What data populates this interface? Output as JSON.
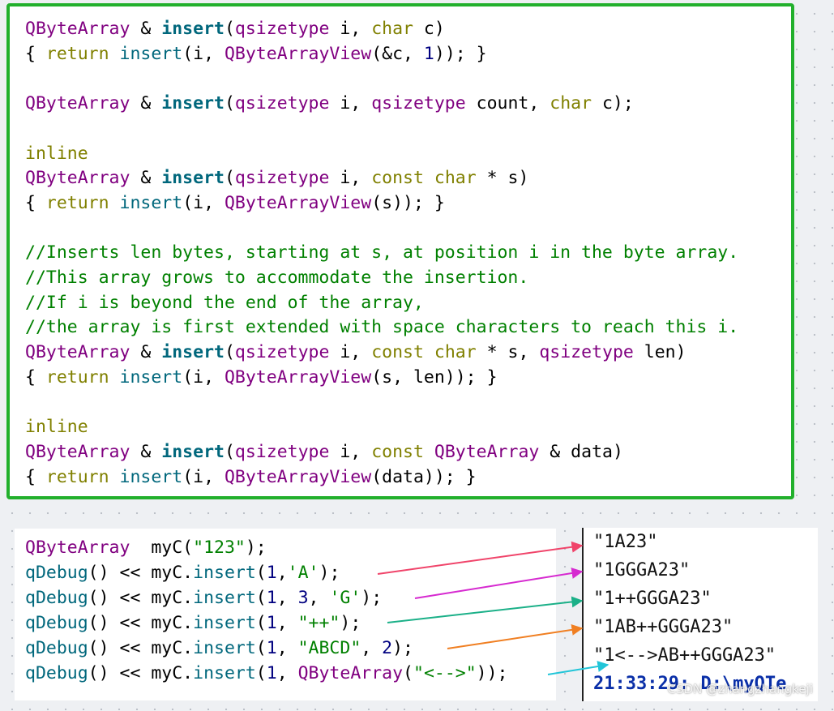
{
  "code_lines": [
    [
      [
        "QByteArray",
        "ty"
      ],
      [
        " & ",
        ""
      ],
      [
        "insert",
        "fnb"
      ],
      [
        "(",
        ""
      ],
      [
        "qsizetype",
        "ty"
      ],
      [
        " i, ",
        ""
      ],
      [
        "char",
        "kw"
      ],
      [
        " c)",
        ""
      ]
    ],
    [
      [
        "{ ",
        ""
      ],
      [
        "return",
        "kw"
      ],
      [
        " ",
        ""
      ],
      [
        "insert",
        "fn"
      ],
      [
        "(i, ",
        ""
      ],
      [
        "QByteArrayView",
        "ty"
      ],
      [
        "(&c, ",
        ""
      ],
      [
        "1",
        "num"
      ],
      [
        ")); }",
        ""
      ]
    ],
    [],
    [
      [
        "QByteArray",
        "ty"
      ],
      [
        " & ",
        ""
      ],
      [
        "insert",
        "fnb"
      ],
      [
        "(",
        ""
      ],
      [
        "qsizetype",
        "ty"
      ],
      [
        " i, ",
        ""
      ],
      [
        "qsizetype",
        "ty"
      ],
      [
        " count, ",
        ""
      ],
      [
        "char",
        "kw"
      ],
      [
        " c);",
        ""
      ]
    ],
    [],
    [
      [
        "inline",
        "kw"
      ]
    ],
    [
      [
        "QByteArray",
        "ty"
      ],
      [
        " & ",
        ""
      ],
      [
        "insert",
        "fnb"
      ],
      [
        "(",
        ""
      ],
      [
        "qsizetype",
        "ty"
      ],
      [
        " i, ",
        ""
      ],
      [
        "const",
        "kw"
      ],
      [
        " ",
        ""
      ],
      [
        "char",
        "kw"
      ],
      [
        " * s)",
        ""
      ]
    ],
    [
      [
        "{ ",
        ""
      ],
      [
        "return",
        "kw"
      ],
      [
        " ",
        ""
      ],
      [
        "insert",
        "fn"
      ],
      [
        "(i, ",
        ""
      ],
      [
        "QByteArrayView",
        "ty"
      ],
      [
        "(s)); }",
        ""
      ]
    ],
    [],
    [
      [
        "//Inserts len bytes, starting at s, at position i in the byte array.",
        "cm"
      ]
    ],
    [
      [
        "//This array grows to accommodate the insertion.",
        "cm"
      ]
    ],
    [
      [
        "//If i is beyond the end of the array,",
        "cm"
      ]
    ],
    [
      [
        "//the array is first extended with space characters to reach this i.",
        "cm"
      ]
    ],
    [
      [
        "QByteArray",
        "ty"
      ],
      [
        " & ",
        ""
      ],
      [
        "insert",
        "fnb"
      ],
      [
        "(",
        ""
      ],
      [
        "qsizetype",
        "ty"
      ],
      [
        " i, ",
        ""
      ],
      [
        "const",
        "kw"
      ],
      [
        " ",
        ""
      ],
      [
        "char",
        "kw"
      ],
      [
        " * s, ",
        ""
      ],
      [
        "qsizetype",
        "ty"
      ],
      [
        " len)",
        ""
      ]
    ],
    [
      [
        "{ ",
        ""
      ],
      [
        "return",
        "kw"
      ],
      [
        " ",
        ""
      ],
      [
        "insert",
        "fn"
      ],
      [
        "(i, ",
        ""
      ],
      [
        "QByteArrayView",
        "ty"
      ],
      [
        "(s, len)); }",
        ""
      ]
    ],
    [],
    [
      [
        "inline",
        "kw"
      ]
    ],
    [
      [
        "QByteArray",
        "ty"
      ],
      [
        " & ",
        ""
      ],
      [
        "insert",
        "fnb"
      ],
      [
        "(",
        ""
      ],
      [
        "qsizetype",
        "ty"
      ],
      [
        " i, ",
        ""
      ],
      [
        "const",
        "kw"
      ],
      [
        " ",
        ""
      ],
      [
        "QByteArray",
        "ty"
      ],
      [
        " & data)",
        ""
      ]
    ],
    [
      [
        "{ ",
        ""
      ],
      [
        "return",
        "kw"
      ],
      [
        " ",
        ""
      ],
      [
        "insert",
        "fn"
      ],
      [
        "(i, ",
        ""
      ],
      [
        "QByteArrayView",
        "ty"
      ],
      [
        "(data)); }",
        ""
      ]
    ]
  ],
  "snippet_lines": [
    [
      [
        "QByteArray",
        "ty"
      ],
      [
        "  myC(",
        ""
      ],
      [
        "\"123\"",
        "str"
      ],
      [
        ");",
        ""
      ]
    ],
    [
      [
        "qDebug",
        "fn"
      ],
      [
        "() << myC.",
        ""
      ],
      [
        "insert",
        "fn"
      ],
      [
        "(",
        ""
      ],
      [
        "1",
        "num"
      ],
      [
        ",",
        ""
      ],
      [
        "'A'",
        "str"
      ],
      [
        ");",
        ""
      ]
    ],
    [
      [
        "qDebug",
        "fn"
      ],
      [
        "() << myC.",
        ""
      ],
      [
        "insert",
        "fn"
      ],
      [
        "(",
        ""
      ],
      [
        "1",
        "num"
      ],
      [
        ", ",
        ""
      ],
      [
        "3",
        "num"
      ],
      [
        ", ",
        ""
      ],
      [
        "'G'",
        "str"
      ],
      [
        ");",
        ""
      ]
    ],
    [
      [
        "qDebug",
        "fn"
      ],
      [
        "() << myC.",
        ""
      ],
      [
        "insert",
        "fn"
      ],
      [
        "(",
        ""
      ],
      [
        "1",
        "num"
      ],
      [
        ", ",
        ""
      ],
      [
        "\"++\"",
        "str"
      ],
      [
        ");",
        ""
      ]
    ],
    [
      [
        "qDebug",
        "fn"
      ],
      [
        "() << myC.",
        ""
      ],
      [
        "insert",
        "fn"
      ],
      [
        "(",
        ""
      ],
      [
        "1",
        "num"
      ],
      [
        ", ",
        ""
      ],
      [
        "\"ABCD\"",
        "str"
      ],
      [
        ", ",
        ""
      ],
      [
        "2",
        "num"
      ],
      [
        ");",
        ""
      ]
    ],
    [
      [
        "qDebug",
        "fn"
      ],
      [
        "() << myC.",
        ""
      ],
      [
        "insert",
        "fn"
      ],
      [
        "(",
        ""
      ],
      [
        "1",
        "num"
      ],
      [
        ", ",
        ""
      ],
      [
        "QByteArray",
        "ty"
      ],
      [
        "(",
        ""
      ],
      [
        "\"<-->\"",
        "str"
      ],
      [
        "));",
        ""
      ]
    ]
  ],
  "console": {
    "outputs": [
      "\"1A23\"",
      "\"1GGGA23\"",
      "\"1++GGGA23\"",
      "\"1AB++GGGA23\"",
      "\"1<-->AB++GGGA23\""
    ],
    "timestamp_line": "21:33:29: D:\\myQTe"
  },
  "arrow_colors": [
    "#f0446a",
    "#d62ad0",
    "#1bb088",
    "#f07f22",
    "#22c5d8"
  ],
  "watermark": "CSDN @zhangzhangkeji",
  "colors": {
    "frame": "#22b02c",
    "keyword": "#808000",
    "type": "#800080",
    "function": "#00677c",
    "string": "#008000",
    "number": "#000080"
  }
}
